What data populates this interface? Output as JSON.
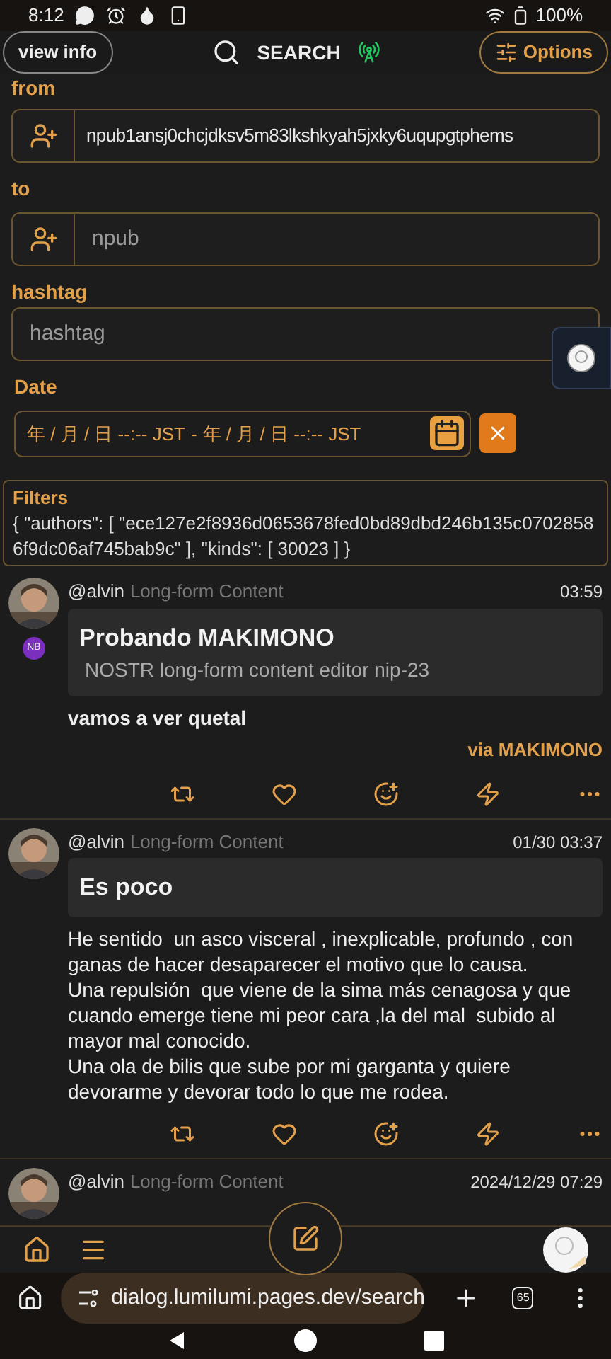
{
  "status_bar": {
    "time": "8:12",
    "battery": "100%"
  },
  "header": {
    "view_info": "view info",
    "title": "SEARCH",
    "options": "Options"
  },
  "form": {
    "from": {
      "label": "from",
      "value": "npub1ansj0chcjdksv5m83lkshkyah5jxky6uqupgtphems"
    },
    "to": {
      "label": "to",
      "placeholder": "npub"
    },
    "hashtag": {
      "label": "hashtag",
      "placeholder": "hashtag"
    },
    "date": {
      "label": "Date",
      "start": "年 / 月 / 日 --:-- JST",
      "separator": "-",
      "end": "年 / 月 / 日 --:-- JST"
    }
  },
  "filters": {
    "label": "Filters",
    "text": "{ \"authors\": [ \"ece127e2f8936d0653678fed0bd89dbd246b135c07028586f9dc06af745bab9c\" ], \"kinds\": [ 30023 ] }"
  },
  "posts": [
    {
      "author": "@alvin",
      "kind_label": "Long-form Content",
      "time": "03:59",
      "badge": "NB",
      "title": "Probando MAKIMONO",
      "summary": "NOSTR long-form content editor nip-23",
      "body": "vamos a ver quetal",
      "body_bold": true,
      "via": "via MAKIMONO"
    },
    {
      "author": "@alvin",
      "kind_label": "Long-form Content",
      "time": "01/30 03:37",
      "title": "Es poco",
      "body": "He sentido  un asco visceral , inexplicable, profundo , con ganas de hacer desaparecer el motivo que lo causa.\nUna repulsión  que viene de la sima más cenagosa y que cuando emerge tiene mi peor cara ,la del mal  subido al mayor mal conocido.\nUna ola de bilis que sube por mi garganta y quiere devorarme y devorar todo lo que me rodea.",
      "body_bold": false
    },
    {
      "author": "@alvin",
      "kind_label": "Long-form Content",
      "time": "2024/12/29 07:29"
    }
  ],
  "browser": {
    "url": "dialog.lumilumi.pages.dev/search",
    "tab_count": "65"
  }
}
